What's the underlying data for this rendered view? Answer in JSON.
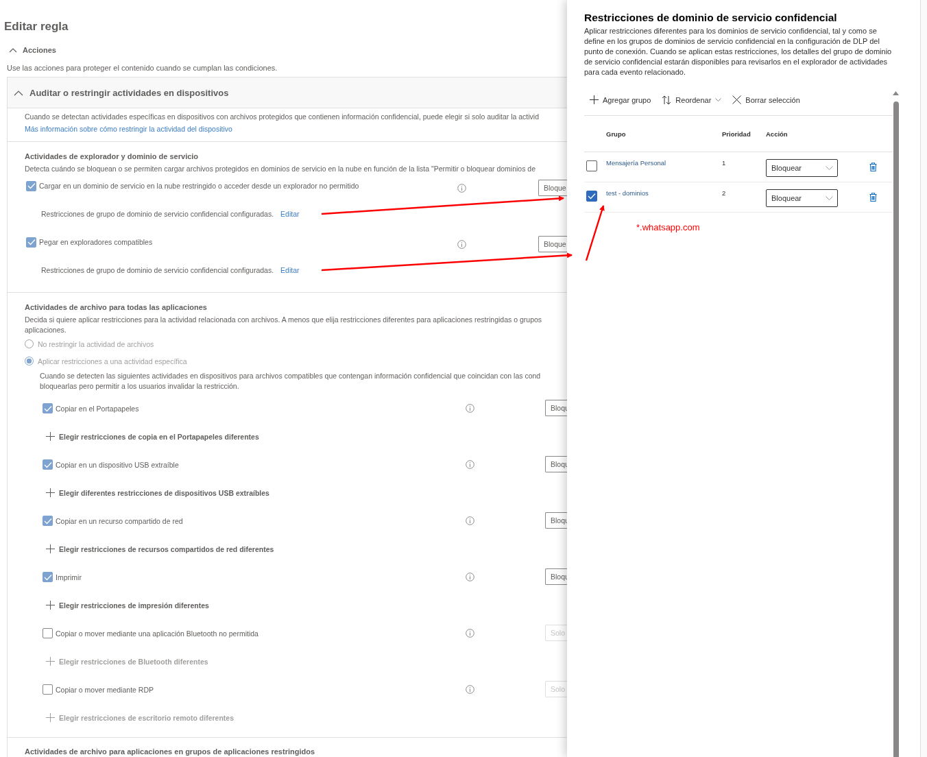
{
  "page": {
    "title": "Editar regla"
  },
  "actions": {
    "label": "Acciones",
    "expanded": true,
    "description": "Use las acciones para proteger el contenido cuando se cumplan las condiciones."
  },
  "section": {
    "title": "Auditar o restringir actividades en dispositivos",
    "expanded": true,
    "intro": "Cuando se detectan actividades específicas en dispositivos con archivos protegidos que contienen información confidencial, puede elegir si solo auditar la activid",
    "link": "Más información sobre cómo restringir la actividad del dispositivo"
  },
  "browser_group": {
    "title": "Actividades de explorador y dominio de servicio",
    "description": "Detecta cuándo se bloquean o se permiten cargar archivos protegidos en dominios de servicio en la nube en función de la lista \"Permitir o bloquear dominios de",
    "items": [
      {
        "label": "Cargar en un dominio de servicio en la nube restringido o acceder desde un explorador no permitido",
        "checked": true,
        "action": "Bloque",
        "note": "Restricciones de grupo de dominio de servicio confidencial configuradas.",
        "link": "Editar"
      },
      {
        "label": "Pegar en exploradores compatibles",
        "checked": true,
        "action": "Bloque",
        "note": "Restricciones de grupo de dominio de servicio confidencial configuradas.",
        "link": "Editar"
      }
    ]
  },
  "file_group": {
    "title": "Actividades de archivo para todas las aplicaciones",
    "description_lines": [
      "Decida si quiere aplicar restricciones para la actividad relacionada con archivos. A menos que elija restricciones diferentes para aplicaciones restringidas o grupos",
      "aplicaciones."
    ],
    "radios": [
      {
        "label": "No restringir la actividad de archivos",
        "selected": false
      },
      {
        "label": "Aplicar restricciones a una actividad específica",
        "selected": true
      }
    ],
    "radio_description_lines": [
      "Cuando se detecten las siguientes actividades en dispositivos para archivos compatibles que contengan información confidencial que coincidan con las cond",
      "bloquearlas pero permitir a los usuarios invalidar la restricción."
    ],
    "items": [
      {
        "label": "Copiar en el Portapapeles",
        "checked": true,
        "action": "Bloqu",
        "option": "Elegir restricciones de copia en el Portapapeles diferentes"
      },
      {
        "label": "Copiar en un dispositivo USB extraíble",
        "checked": true,
        "action": "Bloqu",
        "option": "Elegir diferentes restricciones de dispositivos USB extraíbles"
      },
      {
        "label": "Copiar en un recurso compartido de red",
        "checked": true,
        "action": "Bloqu",
        "option": "Elegir restricciones de recursos compartidos de red diferentes"
      },
      {
        "label": "Imprimir",
        "checked": true,
        "action": "Bloqu",
        "option": "Elegir restricciones de impresión diferentes"
      },
      {
        "label": "Copiar o mover mediante una aplicación Bluetooth no permitida",
        "checked": false,
        "action": "Solo",
        "option": "Elegir restricciones de Bluetooth diferentes"
      },
      {
        "label": "Copiar o mover mediante RDP",
        "checked": false,
        "action": "Solo",
        "option": "Elegir restricciones de escritorio remoto diferentes"
      }
    ]
  },
  "next_group": {
    "title": "Actividades de archivo para aplicaciones en grupos de aplicaciones restringidos"
  },
  "panel": {
    "title": "Restricciones de dominio de servicio confidencial",
    "description": "Aplicar restricciones diferentes para los dominios de servicio confidencial, tal y como se define en los grupos de dominios de servicio confidencial en la configuración de DLP del punto de conexión. Cuando se aplican estas restricciones, los detalles del grupo de dominio de servicio confidencial estarán disponibles para revisarlos en el explorador de actividades para cada evento relacionado.",
    "toolbar": [
      {
        "kind": "add",
        "label": "Agregar grupo"
      },
      {
        "kind": "sort",
        "label": "Reordenar"
      },
      {
        "kind": "clear",
        "label": "Borrar selección"
      }
    ],
    "columns": [
      "Grupo",
      "Prioridad",
      "Acción"
    ],
    "rows": [
      {
        "group": "Mensajería Personal",
        "priority": "1",
        "action": "Bloquear",
        "selected": false
      },
      {
        "group": "test - dominios",
        "priority": "2",
        "action": "Bloquear",
        "selected": true
      }
    ]
  },
  "annotation": {
    "text": "*.whatsapp.com"
  }
}
